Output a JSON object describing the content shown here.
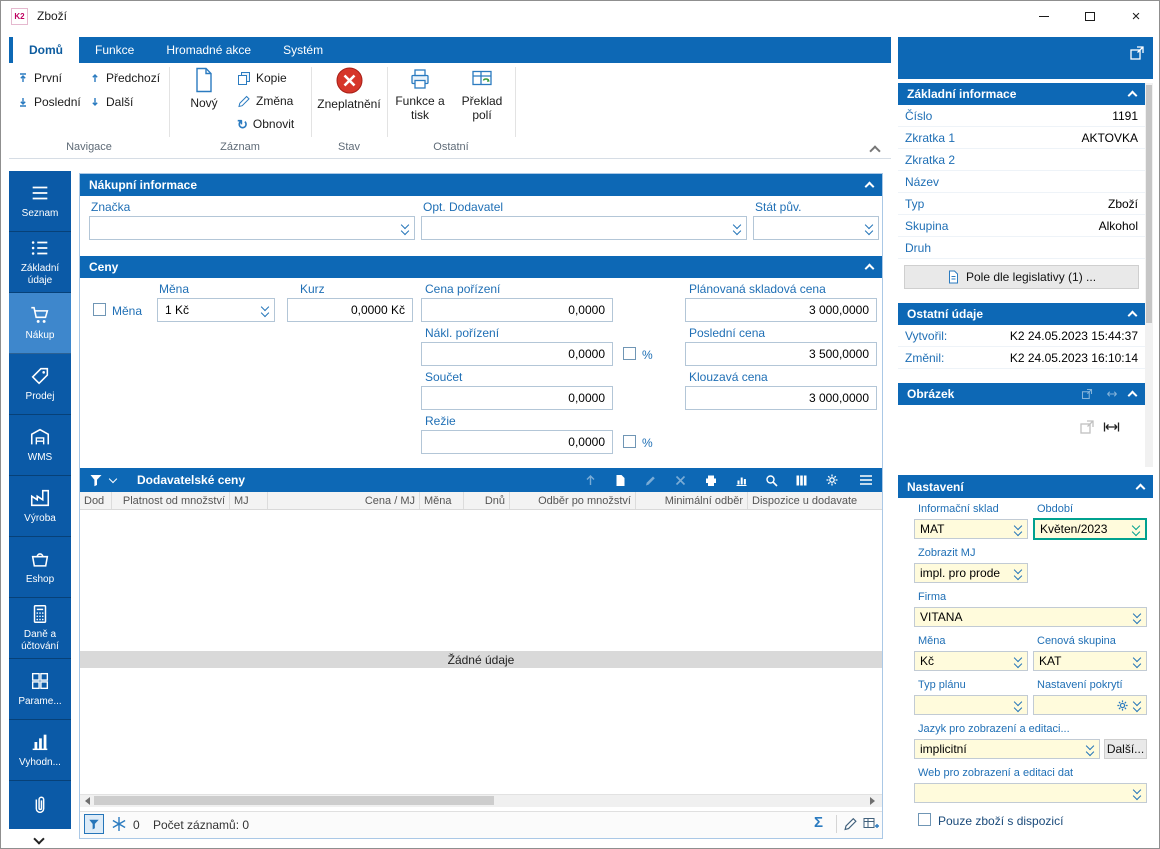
{
  "colors": {
    "accent": "#0d68b5",
    "sidebar": "#0b5aa7",
    "sidebar_active": "#3e87cc",
    "field_yellow": "#fffbdc",
    "focus_teal": "#00a18f",
    "danger": "#d6362a"
  },
  "window": {
    "title": "Zboží"
  },
  "tabs": {
    "items": [
      {
        "label": "Domů"
      },
      {
        "label": "Funkce"
      },
      {
        "label": "Hromadné akce"
      },
      {
        "label": "Systém"
      }
    ]
  },
  "ribbon": {
    "groups": {
      "navigace": {
        "label": "Navigace",
        "prvni": "První",
        "posledni": "Poslední",
        "predchozi": "Předchozí",
        "dalsi": "Další"
      },
      "zaznam": {
        "label": "Záznam",
        "novy": "Nový",
        "kopie": "Kopie",
        "zmena": "Změna",
        "obnovit": "Obnovit"
      },
      "stav": {
        "label": "Stav",
        "zneplatneni": "Zneplatnění"
      },
      "ostatni": {
        "label": "Ostatní",
        "funkce_a_tisk": "Funkce a tisk",
        "preklad_poli": "Překlad polí"
      }
    }
  },
  "sidebar": {
    "items": [
      {
        "label": "Seznam"
      },
      {
        "label": "Základní údaje"
      },
      {
        "label": "Nákup"
      },
      {
        "label": "Prodej"
      },
      {
        "label": "WMS"
      },
      {
        "label": "Výroba"
      },
      {
        "label": "Eshop"
      },
      {
        "label": "Daně a účtování"
      },
      {
        "label": "Parame..."
      },
      {
        "label": "Vyhodn..."
      }
    ]
  },
  "main": {
    "nakup_info": {
      "title": "Nákupní informace",
      "znacka": {
        "label": "Značka",
        "value": ""
      },
      "opt_dodavatel": {
        "label": "Opt. Dodavatel",
        "value": ""
      },
      "stat_puv": {
        "label": "Stát pův.",
        "value": ""
      }
    },
    "ceny": {
      "title": "Ceny",
      "mena_checkbox": "Měna",
      "percent": "%",
      "mena": {
        "label": "Měna",
        "value": "1 Kč"
      },
      "kurz": {
        "label": "Kurz",
        "value": "0,0000 Kč"
      },
      "cena_porizeni": {
        "label": "Cena pořízení",
        "value": "0,0000"
      },
      "planovana_skladova": {
        "label": "Plánovaná skladová cena",
        "value": "3 000,0000"
      },
      "nakl_porizeni": {
        "label": "Nákl. pořízení",
        "value": "0,0000"
      },
      "posledni_cena": {
        "label": "Poslední cena",
        "value": "3 500,0000"
      },
      "soucet": {
        "label": "Součet",
        "value": "0,0000"
      },
      "klouzava_cena": {
        "label": "Klouzavá cena",
        "value": "3 000,0000"
      },
      "rezie": {
        "label": "Režie",
        "value": "0,0000"
      }
    },
    "dodavatelske_ceny": {
      "title": "Dodavatelské ceny",
      "columns": [
        "Dod",
        "Platnost od množství",
        "MJ",
        "Cena / MJ",
        "Měna",
        "Dnů",
        "Odběr po množství",
        "Minimální odběr",
        "Dispozice u dodavate"
      ],
      "empty_text": "Žádné údaje"
    },
    "statusbar": {
      "freeze_count": "0",
      "records_label": "Počet záznamů: 0"
    }
  },
  "right_panel": {
    "zakladni_informace": {
      "title": "Základní informace",
      "rows": [
        {
          "label": "Číslo",
          "value": "1191"
        },
        {
          "label": "Zkratka 1",
          "value": "AKTOVKA"
        },
        {
          "label": "Zkratka 2",
          "value": ""
        },
        {
          "label": "Název",
          "value": ""
        },
        {
          "label": "Typ",
          "value": "Zboží"
        },
        {
          "label": "Skupina",
          "value": "Alkohol"
        },
        {
          "label": "Druh",
          "value": ""
        }
      ],
      "legislativa_button": "Pole dle legislativy (1) ..."
    },
    "ostatni_udaje": {
      "title": "Ostatní údaje",
      "rows": [
        {
          "label": "Vytvořil:",
          "value": "K2 24.05.2023 15:44:37"
        },
        {
          "label": "Změnil:",
          "value": "K2 24.05.2023 16:10:14"
        }
      ]
    },
    "obrazek": {
      "title": "Obrázek"
    },
    "nastaveni": {
      "title": "Nastavení",
      "informacni_sklad": {
        "label": "Informační sklad",
        "value": "MAT"
      },
      "obdobi": {
        "label": "Období",
        "value": "Květen/2023"
      },
      "zobrazit_mj": {
        "label": "Zobrazit MJ",
        "value": "impl. pro prode"
      },
      "firma": {
        "label": "Firma",
        "value": "VITANA"
      },
      "mena": {
        "label": "Měna",
        "value": "Kč"
      },
      "cenova_skupina": {
        "label": "Cenová skupina",
        "value": "KAT"
      },
      "typ_planu": {
        "label": "Typ plánu",
        "value": ""
      },
      "nastaveni_pokryti": {
        "label": "Nastavení pokrytí",
        "value": ""
      },
      "jazyk": {
        "label": "Jazyk pro zobrazení a editaci...",
        "value": "implicitní"
      },
      "dalsi_button": "Další...",
      "web": {
        "label": "Web pro zobrazení a editaci dat",
        "value": ""
      },
      "pouze_checkbox": "Pouze zboží s dispozicí"
    }
  }
}
